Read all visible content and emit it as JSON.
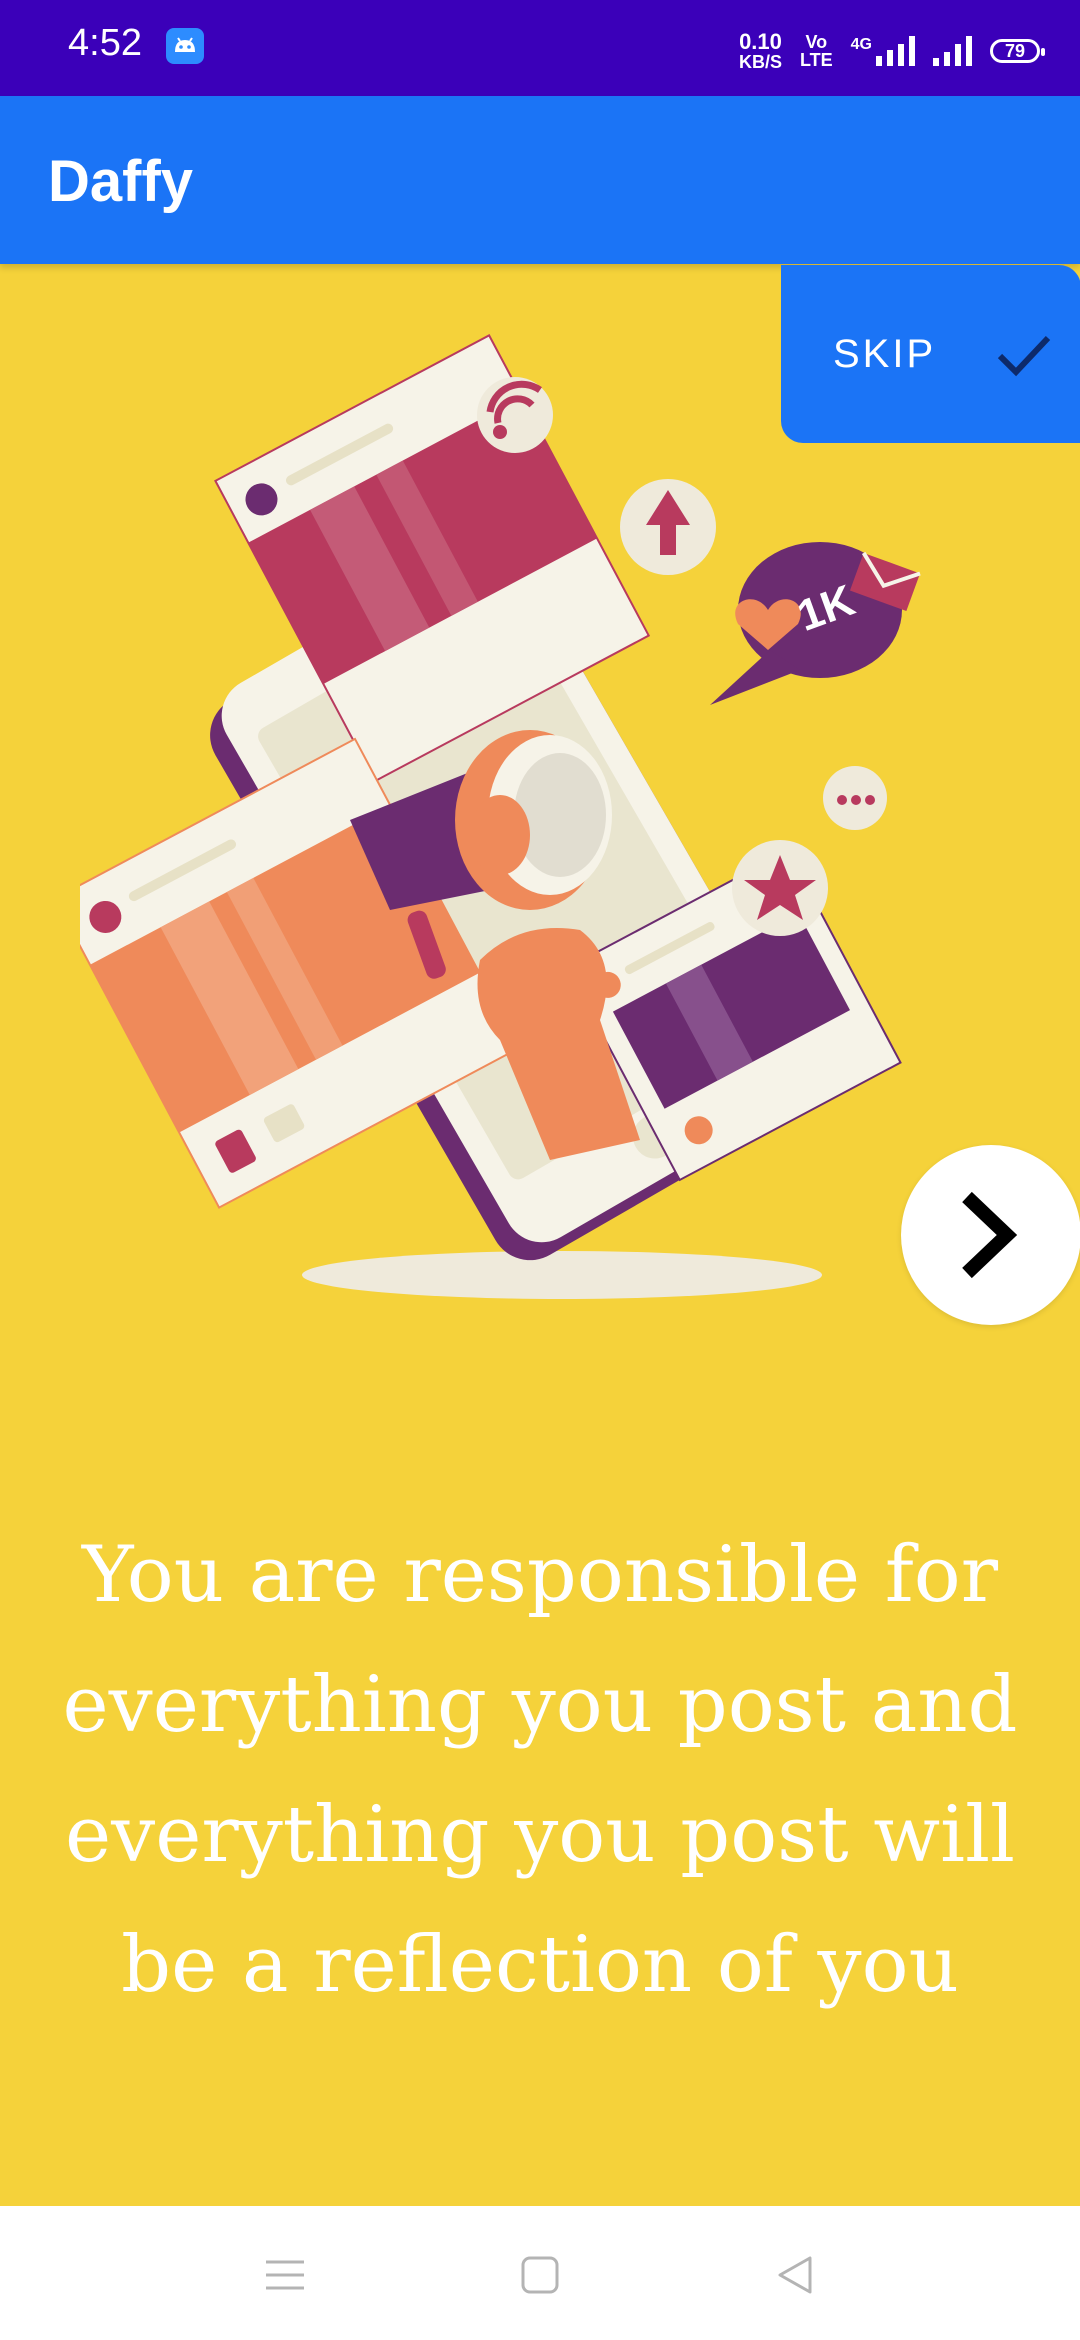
{
  "status": {
    "time": "4:52",
    "speed_value": "0.10",
    "speed_unit": "KB/S",
    "volte_top": "Vo",
    "volte_bottom": "LTE",
    "net_type": "4G",
    "battery": "79"
  },
  "app_bar": {
    "title": "Daffy"
  },
  "skip": {
    "label": "SKIP"
  },
  "onboarding": {
    "quote": "You are responsible for everything you post and everything you post will be a reflection of you",
    "illustration": {
      "badge_text": "1K"
    }
  },
  "colors": {
    "status_bar": "#3b00b9",
    "app_bar": "#1b74f6",
    "background": "#f5d23a",
    "accent_purple": "#6b2c70",
    "accent_red": "#b83a5e",
    "accent_orange": "#ef8a5a"
  },
  "icons": [
    "android-icon",
    "check-icon",
    "chevron-right-icon",
    "menu-icon",
    "home-icon",
    "back-icon"
  ]
}
